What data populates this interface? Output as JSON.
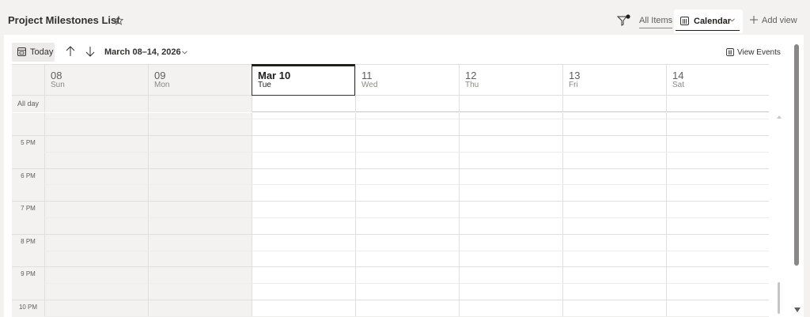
{
  "header": {
    "title": "Project Milestones List",
    "views": {
      "all_items": "All Items",
      "calendar": "Calendar",
      "add_view": "Add view"
    }
  },
  "toolbar": {
    "today": "Today",
    "date_range": "March 08–14, 2026",
    "view_events": "View Events"
  },
  "calendar": {
    "days": [
      {
        "num": "08",
        "name": "Sun"
      },
      {
        "num": "09",
        "name": "Mon"
      },
      {
        "num": "Mar 10",
        "name": "Tue"
      },
      {
        "num": "11",
        "name": "Wed"
      },
      {
        "num": "12",
        "name": "Thu"
      },
      {
        "num": "13",
        "name": "Fri"
      },
      {
        "num": "14",
        "name": "Sat"
      }
    ],
    "today_index": 2,
    "all_day_label": "All day",
    "hours": [
      "5 PM",
      "6 PM",
      "7 PM",
      "8 PM",
      "9 PM",
      "10 PM"
    ]
  },
  "colors": {
    "accent": "#201f1e",
    "weekend_shade": "#f3f2f1",
    "grid_line": "#e1dfdd"
  },
  "icons": [
    "star-icon",
    "filter-icon",
    "calendar-icon",
    "chevron-down-icon",
    "plus-icon",
    "arrow-up-icon",
    "arrow-down-icon"
  ]
}
